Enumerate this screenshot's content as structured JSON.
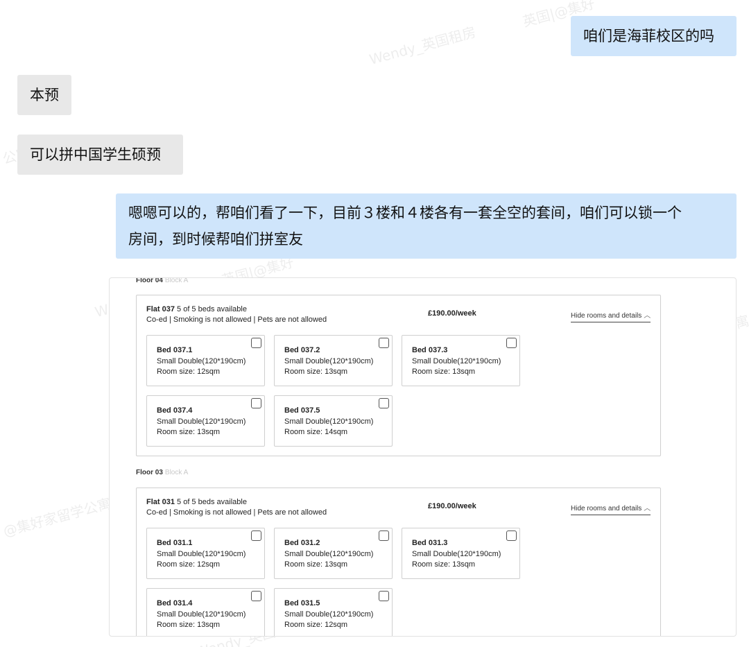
{
  "watermarks": [
    "Wendy_英国租房",
    "英国|@集好",
    "@集好家留学公寓",
    "英国|@集好",
    "Wendy_英国",
    "公寓|@集好",
    "公寓|",
    "W"
  ],
  "messages": [
    {
      "side": "right",
      "text": "咱们是海菲校区的吗"
    },
    {
      "side": "left",
      "text": "本预"
    },
    {
      "side": "left",
      "text": "可以拼中国学生硕预"
    },
    {
      "side": "right",
      "line1": "嗯嗯可以的，帮咱们看了一下，目前３楼和４楼各有一套全空的套间，咱们可以锁一个",
      "line2": "房间，到时候帮咱们拼室友"
    }
  ],
  "floors": [
    {
      "floor": "Floor 04",
      "block": "Block A",
      "flat": {
        "name": "Flat 037",
        "availability": "5 of 5 beds available",
        "features": "Co-ed | Smoking is not allowed | Pets are not allowed",
        "price": "£190.00/week",
        "toggle": "Hide rooms and details",
        "beds": [
          {
            "name": "Bed 037.1",
            "type": "Small Double(120*190cm)",
            "size": "Room size: 12sqm"
          },
          {
            "name": "Bed 037.2",
            "type": "Small Double(120*190cm)",
            "size": "Room size: 13sqm"
          },
          {
            "name": "Bed 037.3",
            "type": "Small Double(120*190cm)",
            "size": "Room size: 13sqm"
          },
          {
            "name": "Bed 037.4",
            "type": "Small Double(120*190cm)",
            "size": "Room size: 13sqm"
          },
          {
            "name": "Bed 037.5",
            "type": "Small Double(120*190cm)",
            "size": "Room size: 14sqm"
          }
        ]
      }
    },
    {
      "floor": "Floor 03",
      "block": "Block A",
      "flat": {
        "name": "Flat 031",
        "availability": "5 of 5 beds available",
        "features": "Co-ed | Smoking is not allowed | Pets are not allowed",
        "price": "£190.00/week",
        "toggle": "Hide rooms and details",
        "beds": [
          {
            "name": "Bed 031.1",
            "type": "Small Double(120*190cm)",
            "size": "Room size: 12sqm"
          },
          {
            "name": "Bed 031.2",
            "type": "Small Double(120*190cm)",
            "size": "Room size: 13sqm"
          },
          {
            "name": "Bed 031.3",
            "type": "Small Double(120*190cm)",
            "size": "Room size: 13sqm"
          },
          {
            "name": "Bed 031.4",
            "type": "Small Double(120*190cm)",
            "size": "Room size: 13sqm"
          },
          {
            "name": "Bed 031.5",
            "type": "Small Double(120*190cm)",
            "size": "Room size: 12sqm"
          }
        ]
      }
    }
  ],
  "colors": {
    "right_bubble": "#cfe5fb",
    "left_bubble": "#e8e8e8"
  }
}
